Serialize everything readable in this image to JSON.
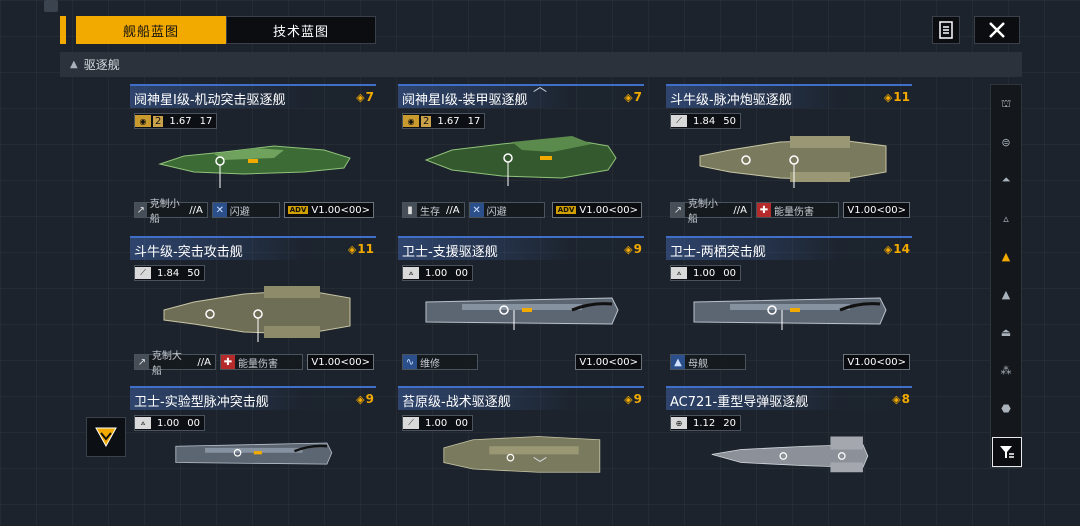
{
  "header": {
    "tabs": [
      {
        "label": "舰船蓝图",
        "active": true
      },
      {
        "label": "技术蓝图",
        "active": false
      }
    ],
    "icons": [
      "document-icon",
      "close-icon"
    ]
  },
  "section": {
    "label": "驱逐舰"
  },
  "colors": {
    "accent": "#f2a900",
    "title_bar": "#3f6fc9",
    "tag_red": "#b52b2b",
    "tag_blue": "#2a4f8a"
  },
  "cards": [
    {
      "title": "阋神星I级-机动突击驱逐舰",
      "cost": "7",
      "rank": "2",
      "tech": "1.67",
      "tech2": "17",
      "tags": [
        {
          "label": "克制小船",
          "grade": "//A",
          "icon": "grey"
        },
        {
          "label": "闪避",
          "grade": "",
          "icon": "blue"
        }
      ],
      "version": "V1.00<00>",
      "badge": "ADV"
    },
    {
      "title": "阋神星I级-装甲驱逐舰",
      "cost": "7",
      "rank": "2",
      "tech": "1.67",
      "tech2": "17",
      "tags": [
        {
          "label": "生存",
          "grade": "//A",
          "icon": "grey"
        },
        {
          "label": "闪避",
          "grade": "",
          "icon": "blue"
        }
      ],
      "version": "V1.00<00>",
      "badge": "ADV"
    },
    {
      "title": "斗牛级-脉冲炮驱逐舰",
      "cost": "11",
      "rank": "",
      "tech": "1.84",
      "tech2": "50",
      "tags": [
        {
          "label": "克制小船",
          "grade": "//A",
          "icon": "grey"
        },
        {
          "label": "能量伤害",
          "grade": "",
          "icon": "red"
        }
      ],
      "version": "V1.00<00>",
      "badge": ""
    },
    {
      "title": "斗牛级-突击攻击舰",
      "cost": "11",
      "rank": "",
      "tech": "1.84",
      "tech2": "50",
      "tags": [
        {
          "label": "克制大船",
          "grade": "//A",
          "icon": "grey"
        },
        {
          "label": "能量伤害",
          "grade": "",
          "icon": "red"
        }
      ],
      "version": "V1.00<00>",
      "badge": ""
    },
    {
      "title": "卫士-支援驱逐舰",
      "cost": "9",
      "rank": "",
      "tech": "1.00",
      "tech2": "00",
      "tags": [
        {
          "label": "维修",
          "grade": "",
          "icon": "blue"
        }
      ],
      "version": "V1.00<00>",
      "badge": ""
    },
    {
      "title": "卫士-两栖突击舰",
      "cost": "14",
      "rank": "",
      "tech": "1.00",
      "tech2": "00",
      "tags": [
        {
          "label": "母舰",
          "grade": "",
          "icon": "blue"
        }
      ],
      "version": "V1.00<00>",
      "badge": ""
    },
    {
      "title": "卫士-实验型脉冲突击舰",
      "cost": "9",
      "rank": "",
      "tech": "1.00",
      "tech2": "00",
      "tags": [],
      "version": "",
      "badge": ""
    },
    {
      "title": "苔原级-战术驱逐舰",
      "cost": "9",
      "rank": "",
      "tech": "1.00",
      "tech2": "00",
      "tags": [],
      "version": "",
      "badge": ""
    },
    {
      "title": "AC721-重型导弹驱逐舰",
      "cost": "8",
      "rank": "",
      "tech": "1.12",
      "tech2": "20",
      "tags": [],
      "version": "",
      "badge": ""
    }
  ],
  "sidebar": {
    "items": [
      "frigate-icon",
      "corvette-icon",
      "destroyer-icon",
      "cruiser-icon",
      "destroyer-active-icon",
      "battlecruiser-icon",
      "carrier-icon",
      "auxiliary-icon",
      "flagship-icon"
    ],
    "filter": "filter-icon"
  }
}
